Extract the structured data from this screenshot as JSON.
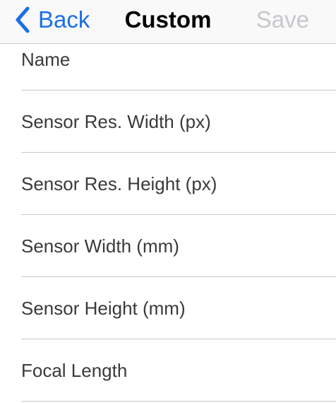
{
  "nav": {
    "back_label": "Back",
    "title": "Custom",
    "save_label": "Save",
    "accent_color": "#1a6fe8",
    "disabled_color": "#c7c7cc"
  },
  "form": {
    "rows": [
      {
        "label": "Name",
        "value": ""
      },
      {
        "label": "Sensor Res. Width (px)",
        "value": ""
      },
      {
        "label": "Sensor Res. Height (px)",
        "value": ""
      },
      {
        "label": "Sensor Width (mm)",
        "value": ""
      },
      {
        "label": "Sensor Height (mm)",
        "value": ""
      },
      {
        "label": "Focal Length",
        "value": ""
      }
    ]
  }
}
